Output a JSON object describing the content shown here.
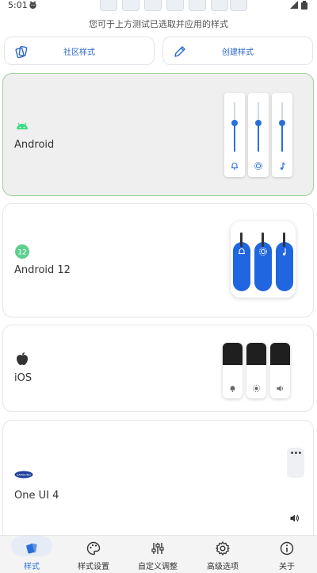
{
  "status": {
    "time": "5:01"
  },
  "hint": "您可于上方测试已选取并应用的样式",
  "buttons": {
    "community": "社区样式",
    "create": "创建样式"
  },
  "styles": [
    {
      "name": "Android",
      "selected": true
    },
    {
      "name": "Android 12"
    },
    {
      "name": "iOS"
    },
    {
      "name": "One UI 4",
      "logo_text": "SAMSUNG"
    }
  ],
  "bottom_nav": [
    {
      "label": "样式",
      "active": true
    },
    {
      "label": "样式设置"
    },
    {
      "label": "自定义调整"
    },
    {
      "label": "高级选项"
    },
    {
      "label": "关于"
    }
  ],
  "colors": {
    "accent": "#2b6fd8",
    "android_green": "#3ddc84",
    "selected_border": "#9fd39c"
  }
}
